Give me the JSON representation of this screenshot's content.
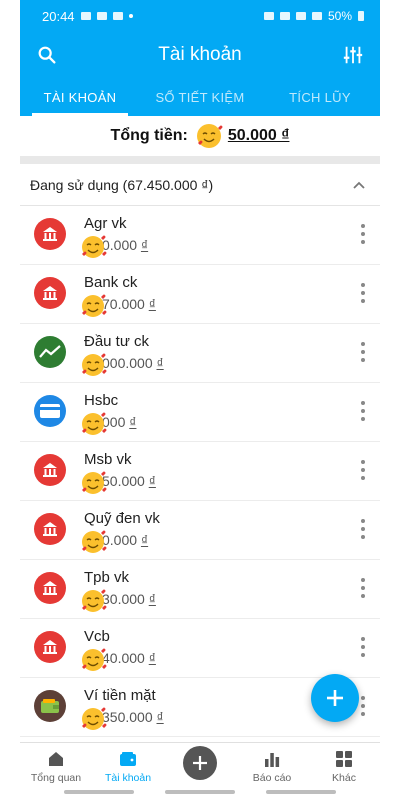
{
  "status": {
    "time": "20:44",
    "battery": "50%"
  },
  "appbar": {
    "title": "Tài khoản"
  },
  "tabs": [
    {
      "label": "TÀI KHOẢN",
      "active": true
    },
    {
      "label": "SỔ TIẾT KIỆM",
      "active": false
    },
    {
      "label": "TÍCH LŨY",
      "active": false
    }
  ],
  "total": {
    "label": "Tổng tiền:",
    "amount": "50.000 ₫"
  },
  "section": {
    "label": "Đang sử dụng (67.450.000 ₫)"
  },
  "accounts": [
    {
      "name": "Agr vk",
      "balance": "0.000",
      "currency": "₫",
      "icon": "bank-icon",
      "color": "#e53935"
    },
    {
      "name": "Bank ck",
      "balance": "70.000",
      "currency": "₫",
      "icon": "bank-icon",
      "color": "#e53935"
    },
    {
      "name": "Đầu tư ck",
      "balance": "000.000",
      "currency": "₫",
      "icon": "chart-icon",
      "color": "#2e7d32"
    },
    {
      "name": "Hsbc",
      "balance": "000",
      "currency": "₫",
      "icon": "card-icon",
      "color": "#1e88e5"
    },
    {
      "name": "Msb vk",
      "balance": "50.000",
      "currency": "₫",
      "icon": "bank-icon",
      "color": "#e53935"
    },
    {
      "name": "Quỹ đen vk",
      "balance": "0.000",
      "currency": "₫",
      "icon": "bank-icon",
      "color": "#e53935"
    },
    {
      "name": "Tpb vk",
      "balance": "30.000",
      "currency": "₫",
      "icon": "bank-icon",
      "color": "#e53935"
    },
    {
      "name": "Vcb",
      "balance": "40.000",
      "currency": "₫",
      "icon": "bank-icon",
      "color": "#e53935"
    },
    {
      "name": "Ví tiền mặt",
      "balance": "350.000",
      "currency": "₫",
      "icon": "wallet-icon",
      "color": "#5d4037"
    }
  ],
  "bottom_nav": [
    {
      "label": "Tổng quan",
      "icon": "home-icon",
      "active": false
    },
    {
      "label": "Tài khoản",
      "icon": "wallet-icon",
      "active": true
    },
    {
      "label": "",
      "icon": "add-icon",
      "active": false
    },
    {
      "label": "Báo cáo",
      "icon": "bar-chart-icon",
      "active": false
    },
    {
      "label": "Khác",
      "icon": "grid-icon",
      "active": false
    }
  ],
  "colors": {
    "primary": "#03a9f4",
    "bank": "#e53935",
    "invest": "#2e7d32",
    "card": "#1e88e5",
    "wallet": "#5d4037"
  }
}
